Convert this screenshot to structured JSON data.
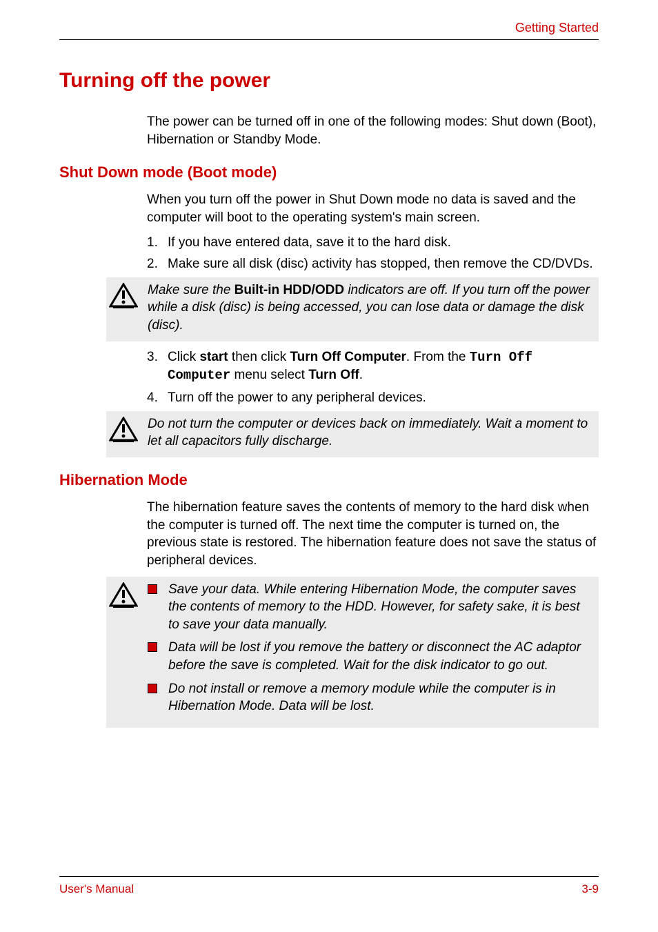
{
  "header": {
    "section_name": "Getting Started"
  },
  "main_heading": "Turning off the power",
  "intro": "The power can be turned off in one of the following modes: Shut down (Boot), Hibernation or Standby Mode.",
  "section1": {
    "heading": "Shut Down mode (Boot mode)",
    "para": "When you turn off the power in Shut Down mode no data is saved and the computer will boot to the operating system's main screen.",
    "list1": [
      {
        "num": "1.",
        "text": "If you have entered data, save it to the hard disk."
      },
      {
        "num": "2.",
        "text": "Make sure all disk (disc) activity has stopped, then remove the CD/DVDs."
      }
    ],
    "callout1_pre": "Make sure the ",
    "callout1_bold": "Built-in HDD/ODD",
    "callout1_post": " indicators are off. If you turn off the power while a disk (disc) is being accessed, you can lose data or damage the disk (disc).",
    "list2_item3": {
      "num": "3.",
      "p1": "Click ",
      "b1": "start",
      "p2": " then click ",
      "b2": "Turn Off Computer",
      "p3": ". From the ",
      "m1": "Turn Off Computer",
      "p4": " menu select ",
      "b3": "Turn Off",
      "p5": "."
    },
    "list2_item4": {
      "num": "4.",
      "text": "Turn off the power to any peripheral devices."
    },
    "callout2": "Do not turn the computer or devices back on immediately. Wait a moment to let all capacitors fully discharge."
  },
  "section2": {
    "heading": "Hibernation Mode",
    "para": "The hibernation feature saves the contents of memory to the hard disk when the computer is turned off. The next time the computer is turned on, the previous state is restored. The hibernation feature does not save the status of peripheral devices.",
    "callout_items": [
      "Save your data. While entering Hibernation Mode, the computer saves the contents of memory to the HDD. However, for safety sake, it is best to save your data manually.",
      "Data will be lost if you remove the battery or disconnect the AC adaptor before the save is completed. Wait for the disk indicator to go out.",
      "Do not install or remove a memory module while the computer is in Hibernation Mode. Data will be lost."
    ]
  },
  "footer": {
    "left": "User's Manual",
    "right": "3-9"
  }
}
